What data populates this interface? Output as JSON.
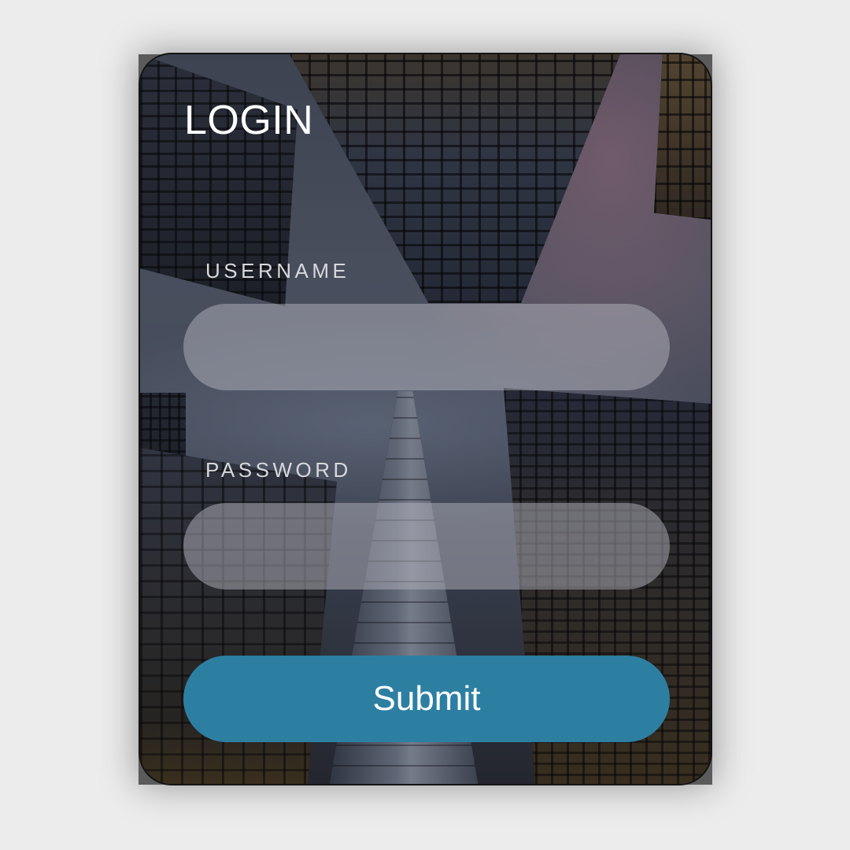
{
  "login_form": {
    "title": "LOGIN",
    "username": {
      "label": "USERNAME",
      "value": "",
      "placeholder": ""
    },
    "password": {
      "label": "PASSWORD",
      "value": "",
      "placeholder": ""
    },
    "submit_label": "Submit"
  },
  "background_image": {
    "subject": "skyscrapers viewed from below"
  },
  "colors": {
    "page_background": "#ececec",
    "submit_button": "#2d7fa2",
    "text": "#ffffff",
    "label_text": "#d8d8dc",
    "input_fill": "rgba(180,180,190,0.5)"
  }
}
